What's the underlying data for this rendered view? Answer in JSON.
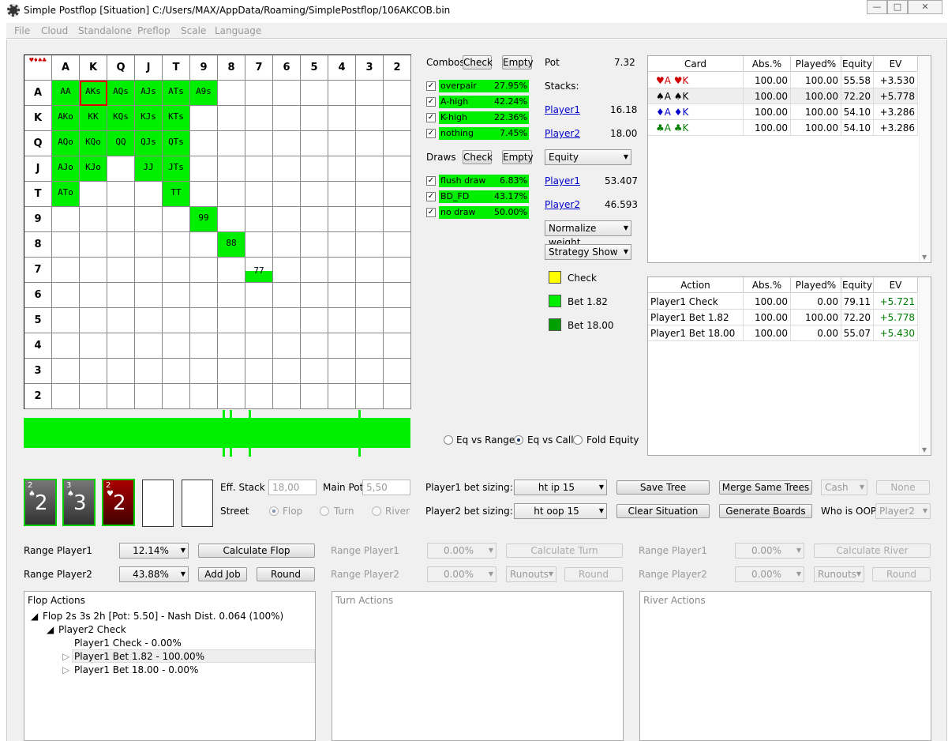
{
  "window": {
    "title": "Simple Postflop [Situation] C:/Users/MAX/AppData/Roaming/SimplePostflop/106AKCOB.bin",
    "btn_min": "—",
    "btn_max": "□",
    "btn_close": "✕"
  },
  "menu": [
    "File",
    "Cloud",
    "Standalone",
    "Preflop",
    "Scale",
    "Language"
  ],
  "grid": {
    "corner_suits": "♥♦♠♣",
    "ranks": [
      "A",
      "K",
      "Q",
      "J",
      "T",
      "9",
      "8",
      "7",
      "6",
      "5",
      "4",
      "3",
      "2"
    ],
    "cells": [
      {
        "r": 0,
        "c": 0,
        "t": "AA"
      },
      {
        "r": 0,
        "c": 1,
        "t": "AKs",
        "sel": true
      },
      {
        "r": 0,
        "c": 2,
        "t": "AQs"
      },
      {
        "r": 0,
        "c": 3,
        "t": "AJs"
      },
      {
        "r": 0,
        "c": 4,
        "t": "ATs"
      },
      {
        "r": 0,
        "c": 5,
        "t": "A9s"
      },
      {
        "r": 1,
        "c": 0,
        "t": "AKo"
      },
      {
        "r": 1,
        "c": 1,
        "t": "KK"
      },
      {
        "r": 1,
        "c": 2,
        "t": "KQs"
      },
      {
        "r": 1,
        "c": 3,
        "t": "KJs"
      },
      {
        "r": 1,
        "c": 4,
        "t": "KTs"
      },
      {
        "r": 2,
        "c": 0,
        "t": "AQo"
      },
      {
        "r": 2,
        "c": 1,
        "t": "KQo"
      },
      {
        "r": 2,
        "c": 2,
        "t": "QQ"
      },
      {
        "r": 2,
        "c": 3,
        "t": "QJs"
      },
      {
        "r": 2,
        "c": 4,
        "t": "QTs"
      },
      {
        "r": 3,
        "c": 0,
        "t": "AJo"
      },
      {
        "r": 3,
        "c": 1,
        "t": "KJo"
      },
      {
        "r": 3,
        "c": 3,
        "t": "JJ"
      },
      {
        "r": 3,
        "c": 4,
        "t": "JTs"
      },
      {
        "r": 4,
        "c": 0,
        "t": "ATo"
      },
      {
        "r": 4,
        "c": 4,
        "t": "TT"
      },
      {
        "r": 5,
        "c": 5,
        "t": "99"
      },
      {
        "r": 6,
        "c": 6,
        "t": "88"
      },
      {
        "r": 7,
        "c": 7,
        "t": "77",
        "partial": true
      }
    ]
  },
  "combos": {
    "label": "Combos",
    "check": "Check",
    "empty": "Empty",
    "items": [
      {
        "name": "overpair",
        "pct": "27.95%"
      },
      {
        "name": "A-high",
        "pct": "42.24%"
      },
      {
        "name": "K-high",
        "pct": "22.36%"
      },
      {
        "name": "nothing",
        "pct": "7.45%"
      }
    ]
  },
  "draws": {
    "label": "Draws",
    "check": "Check",
    "empty": "Empty",
    "items": [
      {
        "name": "flush draw",
        "pct": "6.83%"
      },
      {
        "name": "BD_FD",
        "pct": "43.17%"
      },
      {
        "name": "no draw",
        "pct": "50.00%"
      }
    ]
  },
  "pot": {
    "label": "Pot",
    "value": "7.32"
  },
  "stacks": {
    "label": "Stacks:",
    "p1": "Player1",
    "p1v": "16.18",
    "p2": "Player2",
    "p2v": "18.00"
  },
  "equity_select": "Equity",
  "equity": {
    "p1": "Player1",
    "p1v": "53.407",
    "p2": "Player2",
    "p2v": "46.593"
  },
  "normalize_select": "Normalize weight",
  "strategy_select": "Strategy Show",
  "legend": [
    {
      "label": "Check",
      "color": "#ffff00"
    },
    {
      "label": "Bet 1.82",
      "color": "#00ee00"
    },
    {
      "label": "Bet 18.00",
      "color": "#00a000"
    }
  ],
  "radios": {
    "r1": "Eq vs Range",
    "r2": "Eq vs Call",
    "r3": "Fold Equity"
  },
  "card_table": {
    "headers": [
      "Card",
      "Abs.%",
      "Played%",
      "Equity",
      "EV"
    ],
    "rows": [
      {
        "card": "♥A ♥K",
        "abs": "100.00",
        "played": "100.00",
        "eq": "55.58",
        "ev": "+3.530",
        "color": "#d00000"
      },
      {
        "card": "♠A ♠K",
        "abs": "100.00",
        "played": "100.00",
        "eq": "72.20",
        "ev": "+5.778",
        "color": "#000000"
      },
      {
        "card": "♦A ♦K",
        "abs": "100.00",
        "played": "100.00",
        "eq": "54.10",
        "ev": "+3.286",
        "color": "#0000cc"
      },
      {
        "card": "♣A ♣K",
        "abs": "100.00",
        "played": "100.00",
        "eq": "54.10",
        "ev": "+3.286",
        "color": "#008000"
      }
    ]
  },
  "action_table": {
    "headers": [
      "Action",
      "Abs.%",
      "Played%",
      "Equity",
      "EV"
    ],
    "rows": [
      {
        "a": "Player1 Check",
        "abs": "100.00",
        "played": "0.00",
        "eq": "79.11",
        "ev": "+5.721"
      },
      {
        "a": "Player1 Bet 1.82",
        "abs": "100.00",
        "played": "100.00",
        "eq": "72.20",
        "ev": "+5.778"
      },
      {
        "a": "Player1 Bet 18.00",
        "abs": "100.00",
        "played": "0.00",
        "eq": "55.07",
        "ev": "+5.430"
      }
    ]
  },
  "board": [
    {
      "small": "2",
      "suit": "♠",
      "big": "2"
    },
    {
      "small": "3",
      "suit": "♠",
      "big": "3"
    },
    {
      "small": "2",
      "suit": "♥",
      "big": "2"
    }
  ],
  "settings": {
    "eff_stack_label": "Eff. Stack",
    "eff_stack": "18,00",
    "main_pot_label": "Main Pot",
    "main_pot": "5,50",
    "street_label": "Street",
    "flop": "Flop",
    "turn": "Turn",
    "river": "River",
    "p1_sizing_label": "Player1 bet sizing:",
    "p1_sizing": "ht ip 15",
    "p2_sizing_label": "Player2 bet sizing:",
    "p2_sizing": "ht oop 15",
    "save_tree": "Save Tree",
    "clear_situation": "Clear Situation",
    "merge_same_trees": "Merge Same Trees",
    "generate_boards": "Generate Boards",
    "cash": "Cash",
    "none": "None",
    "who_oop_label": "Who is OOP:",
    "who_oop": "Player2"
  },
  "ranges": {
    "rp1": "Range Player1",
    "rp2": "Range Player2",
    "flop_p1": "12.14%",
    "flop_p2": "43.88%",
    "calc_flop": "Calculate Flop",
    "add_job": "Add Job",
    "round": "Round",
    "turn_p1": "0.00%",
    "turn_p2": "0.00%",
    "calc_turn": "Calculate Turn",
    "runouts": "Runouts",
    "river_p1": "0.00%",
    "river_p2": "0.00%",
    "calc_river": "Calculate River"
  },
  "flop_actions": {
    "title": "Flop Actions",
    "n1": "Flop 2s 3s 2h [Pot: 5.50] - Nash Dist. 0.064 (100%)",
    "n2": "Player2 Check",
    "n3": "Player1 Check - 0.00%",
    "n4": "Player1 Bet 1.82 - 100.00%",
    "n5": "Player1 Bet 18.00 - 0.00%"
  },
  "turn_actions": {
    "title": "Turn Actions"
  },
  "river_actions": {
    "title": "River Actions"
  }
}
